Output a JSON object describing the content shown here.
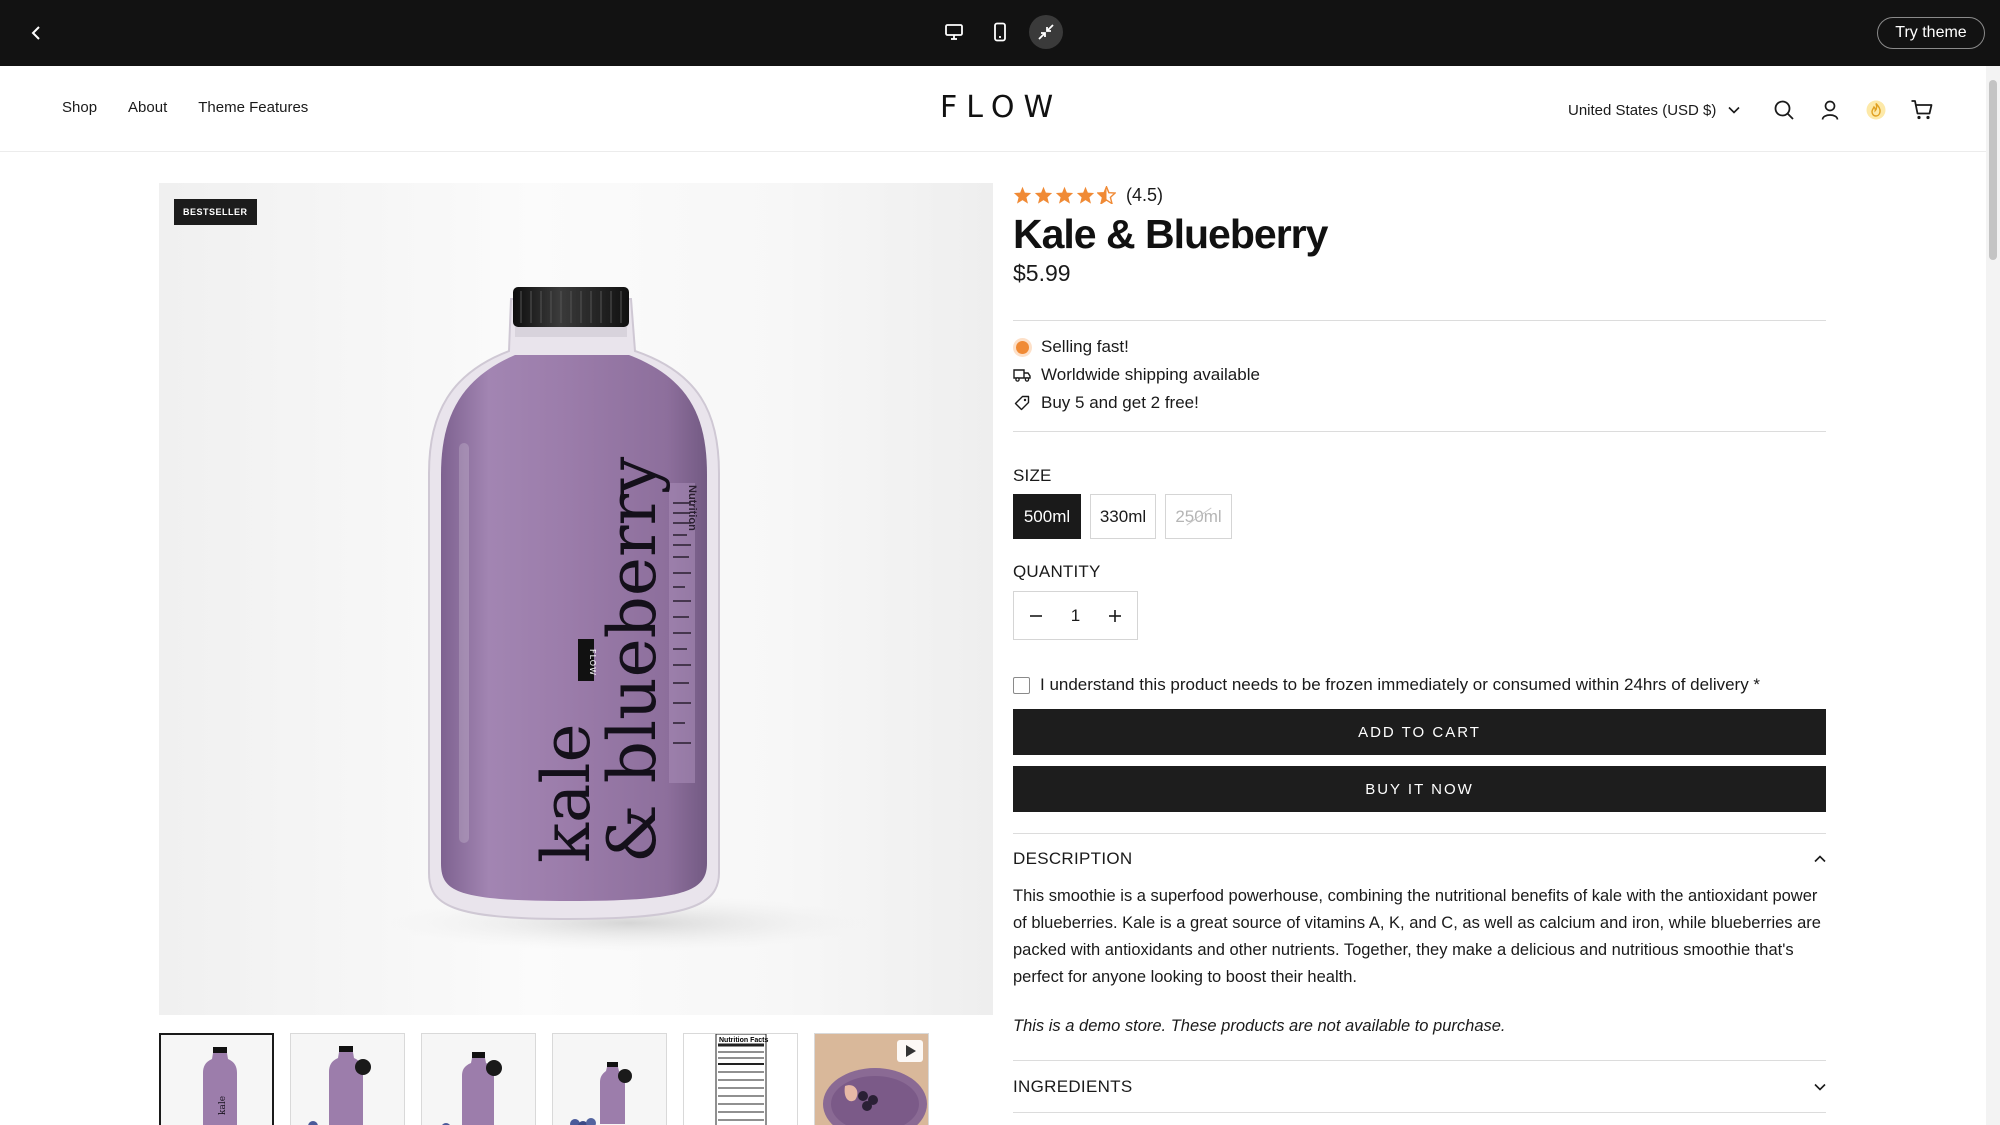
{
  "preview_bar": {
    "try_theme_label": "Try theme",
    "devices": [
      "desktop-icon",
      "mobile-icon",
      "collapse-icon"
    ]
  },
  "header": {
    "nav": [
      {
        "label": "Shop"
      },
      {
        "label": "About"
      },
      {
        "label": "Theme Features"
      }
    ],
    "logo": "FLOW",
    "currency": "United States (USD $)"
  },
  "gallery": {
    "badge": "BESTSELLER",
    "bottle_label_line1": "kale",
    "bottle_label_line2": "& blueberry",
    "bottle_brand": "FLOW",
    "bottle_side_text": "Nutrition",
    "thumb_nutrition_title": "Nutrition Facts",
    "thumbnail_count": 6
  },
  "product": {
    "rating": 4.5,
    "rating_text": "(4.5)",
    "title": "Kale & Blueberry",
    "price": "$5.99",
    "features": [
      {
        "icon": "status-dot-icon",
        "text": "Selling fast!"
      },
      {
        "icon": "truck-icon",
        "text": "Worldwide shipping available"
      },
      {
        "icon": "tag-icon",
        "text": "Buy 5 and get 2 free!"
      }
    ],
    "size_label": "SIZE",
    "sizes": [
      {
        "label": "500ml",
        "state": "selected"
      },
      {
        "label": "330ml",
        "state": "available"
      },
      {
        "label": "250ml",
        "state": "sold-out"
      }
    ],
    "quantity_label": "QUANTITY",
    "quantity": "1",
    "consent_text": "I understand this product needs to be frozen immediately or consumed within 24hrs of delivery *",
    "add_to_cart": "ADD TO CART",
    "buy_now": "BUY IT NOW",
    "description_heading": "DESCRIPTION",
    "description": "This smoothie is a superfood powerhouse, combining the nutritional benefits of kale with the antioxidant power of blueberries. Kale is a great source of vitamins A, K, and C, as well as calcium and iron, while blueberries are packed with antioxidants and other nutrients. Together, they make a delicious and nutritious smoothie that's perfect for anyone looking to boost their health.",
    "demo_notice": "This is a demo store. These products are not available to purchase.",
    "ingredients_heading": "INGREDIENTS"
  },
  "colors": {
    "accent_orange": "#f08a35",
    "button_dark": "#1d1d1d",
    "bottle_purple": "#9a7aa8"
  }
}
